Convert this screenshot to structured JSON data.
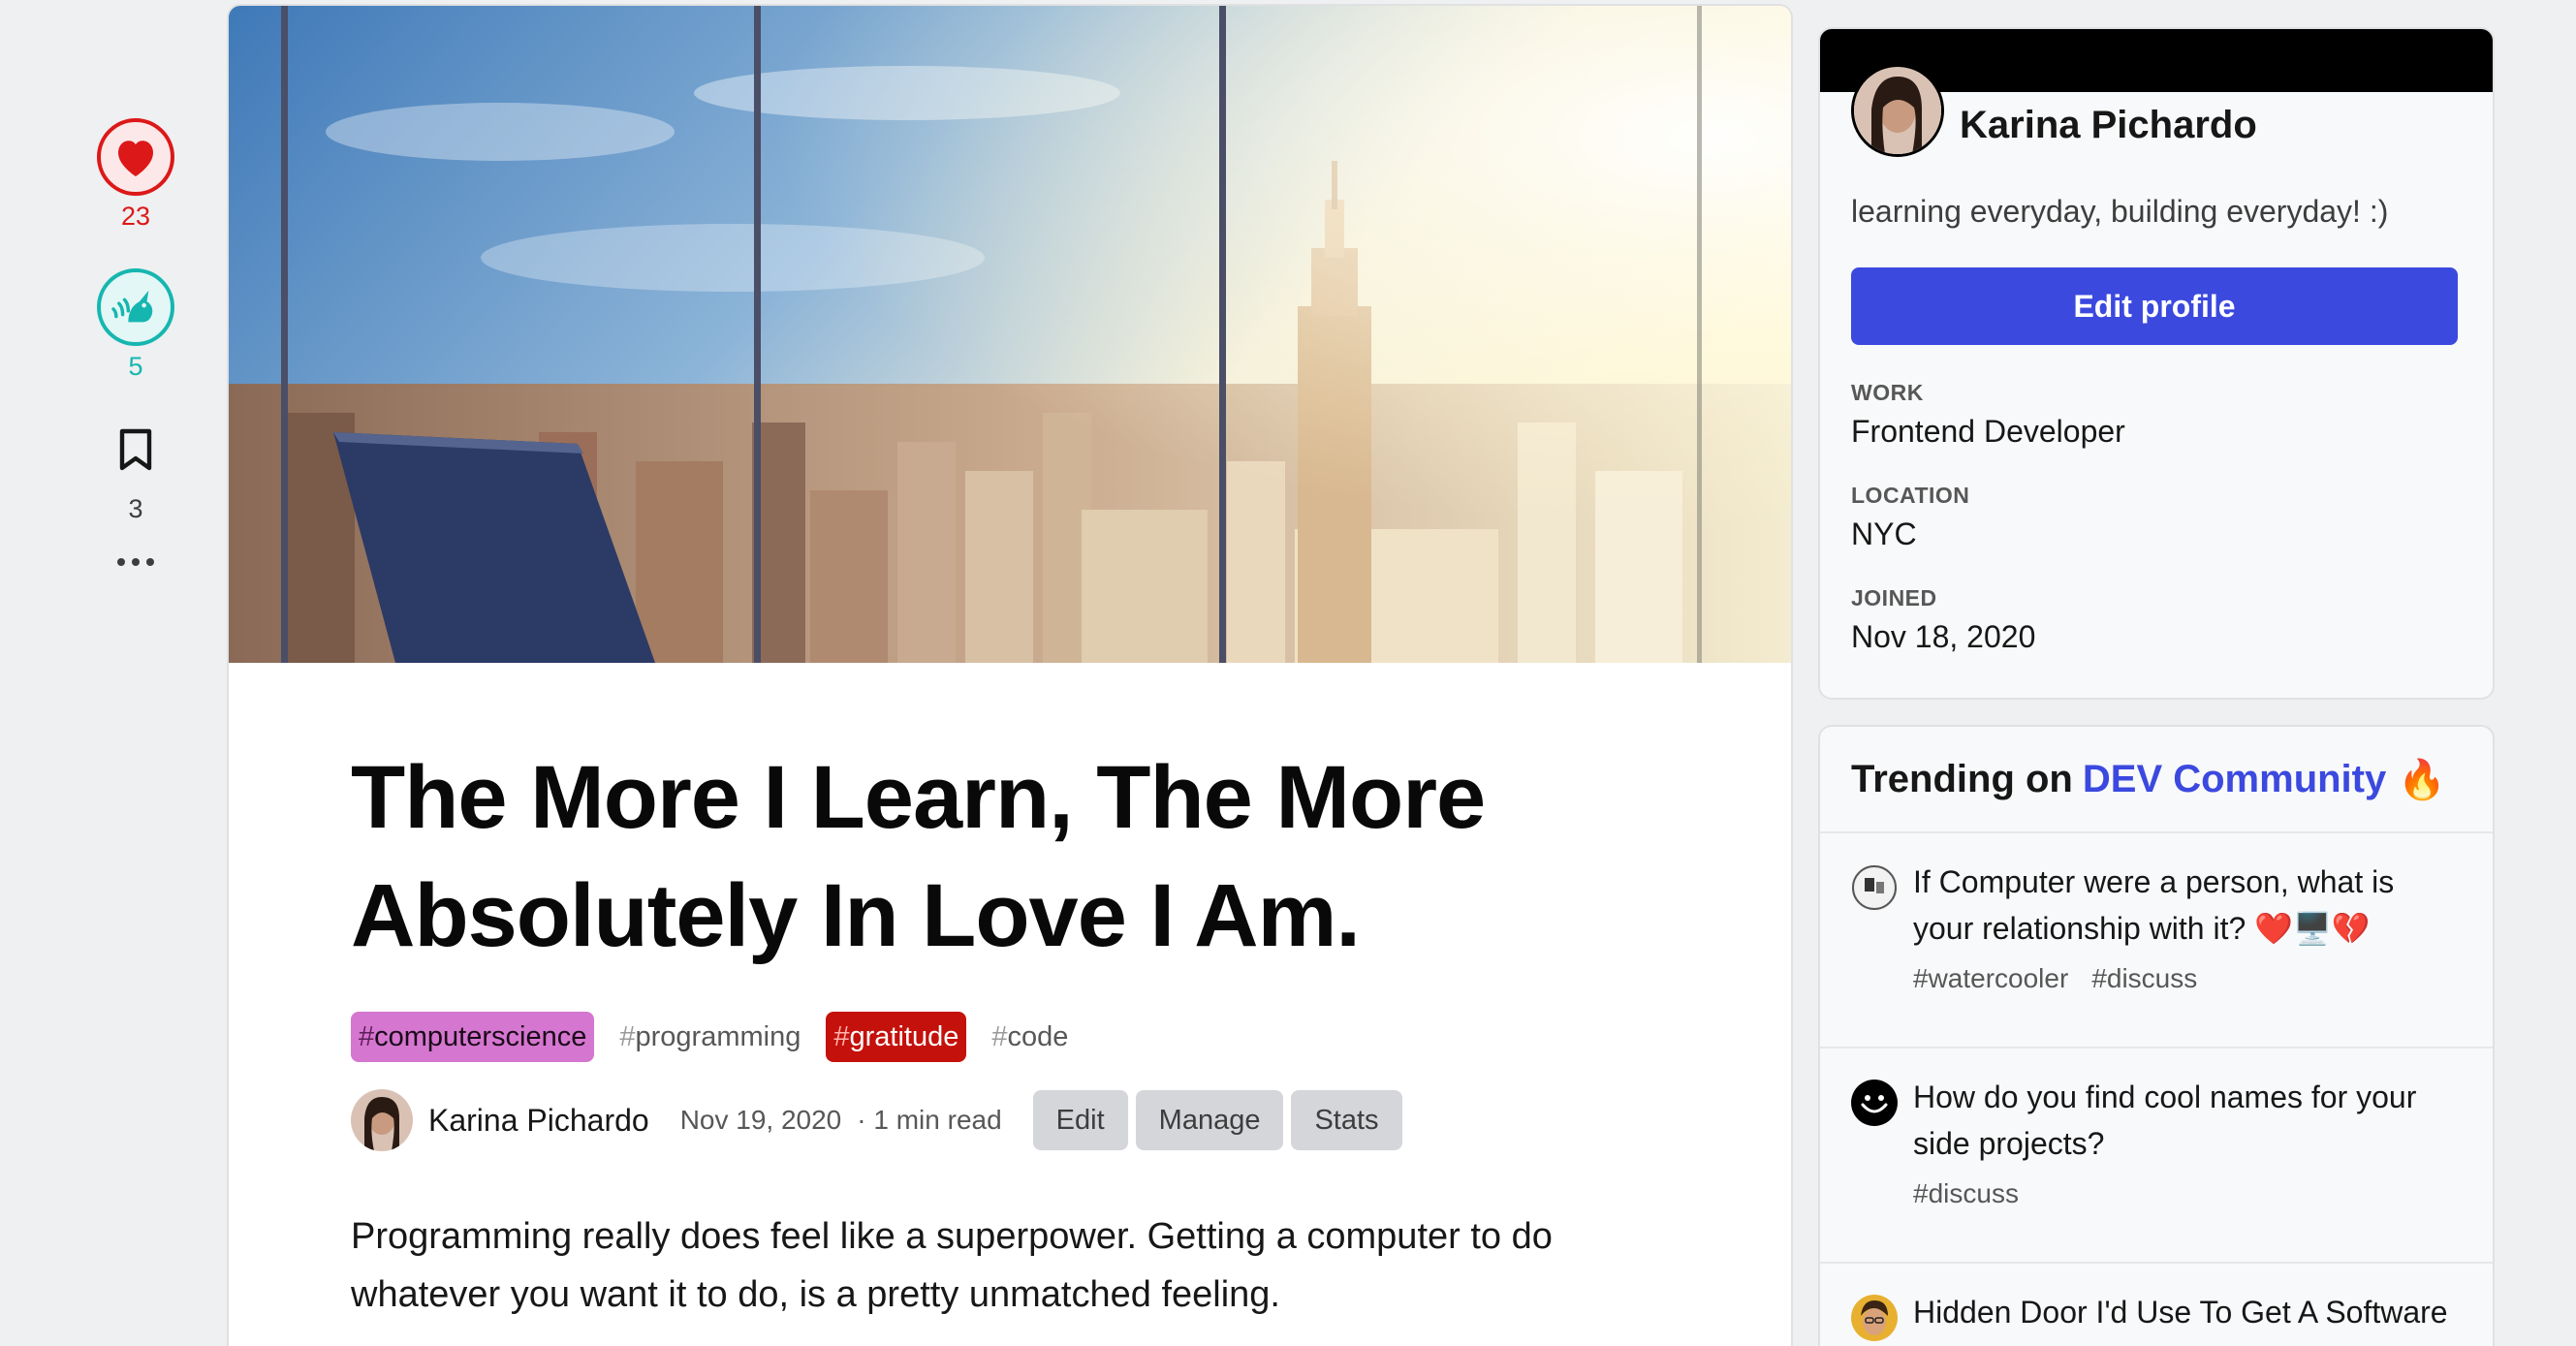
{
  "reactions": {
    "hearts": "23",
    "unicorns": "5",
    "bookmarks": "3",
    "more": "•••"
  },
  "article": {
    "title": "The More I Learn, The More Absolutely In Love I Am.",
    "tags": [
      {
        "hash": "#",
        "name": "computerscience"
      },
      {
        "hash": "#",
        "name": "programming"
      },
      {
        "hash": "#",
        "name": "gratitude"
      },
      {
        "hash": "#",
        "name": "code"
      }
    ],
    "author": "Karina Pichardo",
    "date": "Nov 19, 2020",
    "read_time": "· 1 min read",
    "buttons": {
      "edit": "Edit",
      "manage": "Manage",
      "stats": "Stats"
    },
    "paragraph": "Programming really does feel like a superpower. Getting a computer to do whatever you want it to do, is a pretty unmatched feeling."
  },
  "profile": {
    "name": "Karina Pichardo",
    "bio": "learning everyday, building everyday! :)",
    "edit_label": "Edit profile",
    "work_label": "WORK",
    "work": "Frontend Developer",
    "location_label": "LOCATION",
    "location": "NYC",
    "joined_label": "JOINED",
    "joined": "Nov 18, 2020"
  },
  "trending": {
    "prefix": "Trending on",
    "community": "DEV Community",
    "emoji": "🔥",
    "items": [
      {
        "title": "If Computer were a person, what is your relationship with it? ❤️🖥️💔",
        "tags": [
          "#watercooler",
          "#discuss"
        ]
      },
      {
        "title": "How do you find cool names for your side projects?",
        "tags": [
          "#discuss"
        ]
      },
      {
        "title": "Hidden Door I'd Use To Get A Software",
        "tags": []
      }
    ]
  },
  "colors": {
    "accent": "#3b49df",
    "heart": "#dc1818",
    "unicorn": "#16b6b0",
    "tag_computerscience": "#d576d0",
    "tag_gratitude": "#c4110b"
  }
}
